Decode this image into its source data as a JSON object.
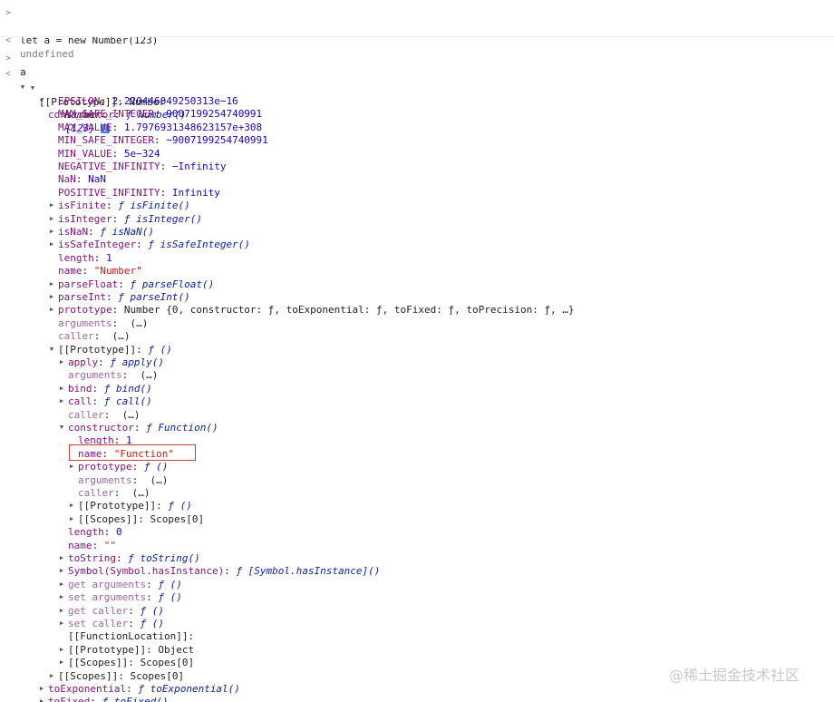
{
  "input1": {
    "prompt": ">",
    "command": "let a = new Number(123)"
  },
  "output1": {
    "marker": "<",
    "text": "undefined"
  },
  "input2": {
    "prompt": ">",
    "command": "a"
  },
  "result": {
    "marker": "<",
    "summary_class": "Number",
    "summary_value": "{123}",
    "info_glyph": "i",
    "proto_key": "[[Prototype]]",
    "proto_value": "Number",
    "constructor_key": "constructor",
    "constructor_value": "ƒ Number()"
  },
  "number_props": [
    {
      "key": "EPSILON",
      "value": "2.220446049250313e−16",
      "kind": "num"
    },
    {
      "key": "MAX_SAFE_INTEGER",
      "value": "9007199254740991",
      "kind": "num"
    },
    {
      "key": "MAX_VALUE",
      "value": "1.7976931348623157e+308",
      "kind": "num"
    },
    {
      "key": "MIN_SAFE_INTEGER",
      "value": "−9007199254740991",
      "kind": "num"
    },
    {
      "key": "MIN_VALUE",
      "value": "5e−324",
      "kind": "num"
    },
    {
      "key": "NEGATIVE_INFINITY",
      "value": "−Infinity",
      "kind": "num"
    },
    {
      "key": "NaN",
      "value": "NaN",
      "kind": "num"
    },
    {
      "key": "POSITIVE_INFINITY",
      "value": "Infinity",
      "kind": "num"
    },
    {
      "key": "isFinite",
      "value": "ƒ isFinite()",
      "kind": "fn"
    },
    {
      "key": "isInteger",
      "value": "ƒ isInteger()",
      "kind": "fn"
    },
    {
      "key": "isNaN",
      "value": "ƒ isNaN()",
      "kind": "fn"
    },
    {
      "key": "isSafeInteger",
      "value": "ƒ isSafeInteger()",
      "kind": "fn"
    },
    {
      "key": "length",
      "value": "1",
      "kind": "num"
    },
    {
      "key": "name",
      "value": "\"Number\"",
      "kind": "str"
    },
    {
      "key": "parseFloat",
      "value": "ƒ parseFloat()",
      "kind": "fn"
    },
    {
      "key": "parseInt",
      "value": "ƒ parseInt()",
      "kind": "fn"
    },
    {
      "key": "prototype",
      "value": "Number {0, constructor: ƒ, toExponential: ƒ, toFixed: ƒ, toPrecision: ƒ, …}",
      "kind": "plain"
    },
    {
      "key": "arguments",
      "value": "(…)",
      "kind": "lazy"
    },
    {
      "key": "caller",
      "value": "(…)",
      "kind": "lazy"
    },
    {
      "key": "[[Prototype]]",
      "value": "ƒ ()",
      "kind": "fn-internal"
    }
  ],
  "function_proto_props": [
    {
      "key": "apply",
      "value": "ƒ apply()",
      "kind": "fn"
    },
    {
      "key": "arguments",
      "value": "(…)",
      "kind": "lazy"
    },
    {
      "key": "bind",
      "value": "ƒ bind()",
      "kind": "fn"
    },
    {
      "key": "call",
      "value": "ƒ call()",
      "kind": "fn"
    },
    {
      "key": "caller",
      "value": "(…)",
      "kind": "lazy"
    },
    {
      "key": "constructor",
      "value": "ƒ Function()",
      "kind": "fn"
    }
  ],
  "function_ctor_props": [
    {
      "key": "length",
      "value": "1",
      "kind": "num"
    },
    {
      "key": "name",
      "value": "\"Function\"",
      "kind": "str"
    },
    {
      "key": "prototype",
      "value": "ƒ ()",
      "kind": "fn"
    },
    {
      "key": "arguments",
      "value": "(…)",
      "kind": "lazy"
    },
    {
      "key": "caller",
      "value": "(…)",
      "kind": "lazy"
    },
    {
      "key": "[[Prototype]]",
      "value": "ƒ ()",
      "kind": "fn-internal"
    },
    {
      "key": "[[Scopes]]",
      "value": "Scopes[0]",
      "kind": "internal"
    }
  ],
  "function_proto_rest": [
    {
      "key": "length",
      "value": "0",
      "kind": "num"
    },
    {
      "key": "name",
      "value": "\"\"",
      "kind": "str"
    },
    {
      "key": "toString",
      "value": "ƒ toString()",
      "kind": "fn"
    },
    {
      "key": "Symbol(Symbol.hasInstance)",
      "value": "ƒ [Symbol.hasInstance]()",
      "kind": "fn"
    },
    {
      "key": "get arguments",
      "value": "ƒ ()",
      "kind": "fn-dim"
    },
    {
      "key": "set arguments",
      "value": "ƒ ()",
      "kind": "fn-dim"
    },
    {
      "key": "get caller",
      "value": "ƒ ()",
      "kind": "fn-dim"
    },
    {
      "key": "set caller",
      "value": "ƒ ()",
      "kind": "fn-dim"
    },
    {
      "key": "[[FunctionLocation]]",
      "value": "",
      "kind": "internal"
    },
    {
      "key": "[[Prototype]]",
      "value": "Object",
      "kind": "internal"
    },
    {
      "key": "[[Scopes]]",
      "value": "Scopes[0]",
      "kind": "internal"
    }
  ],
  "tail_props": [
    {
      "key": "[[Scopes]]",
      "value": "Scopes[0]",
      "kind": "internal"
    },
    {
      "key": "toExponential",
      "value": "ƒ toExponential()",
      "kind": "fn"
    },
    {
      "key": "toFixed",
      "value": "ƒ toFixed()",
      "kind": "fn"
    }
  ],
  "watermark": "@稀土掘金技术社区",
  "colors": {
    "key": "#881280",
    "number": "#1c00cf",
    "string": "#c41a16",
    "function": "#0d22aa",
    "highlight_border": "#d23b3b",
    "info_badge": "#3d7fe6"
  }
}
